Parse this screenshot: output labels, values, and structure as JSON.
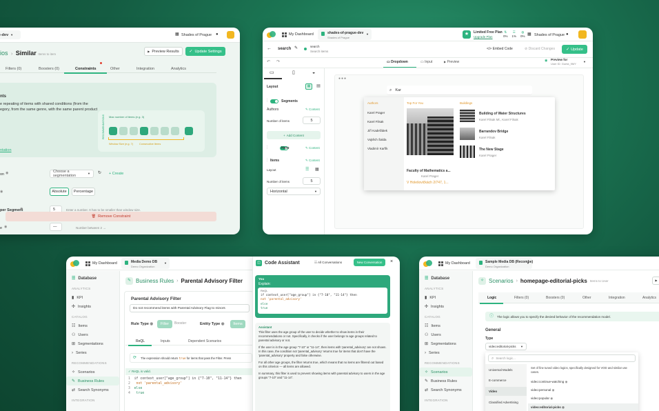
{
  "brand": {
    "green": "#2db37f",
    "yellow": "#f2b720"
  },
  "c1": {
    "project": "ague-dev",
    "org": "Shades of Prague",
    "breadcrumb_a": "ios",
    "breadcrumb_b": "Similar",
    "breadcrumb_c": "Items to item",
    "preview_btn": "Preview Results",
    "update_btn": "Update Settings",
    "tabs": [
      "Filters (0)",
      "Boosters (0)",
      "Constraints",
      "Other",
      "Integration",
      "Analytics"
    ],
    "banner_lines": [
      "nts",
      "e repeating of items with shared conditions (from the",
      "egory, from the same genre, with the same parent product"
    ],
    "banner_link": "ntation",
    "diag_max": "Max number of items (e.g. 3)",
    "diag_window": "Window Size (e.g. 7)",
    "diag_consec": "Consecutive Items",
    "diag_side": "RECOMMENDATIONS",
    "row1_label": "on",
    "row1_select": "Choose a segmentation",
    "row1_create": "Create",
    "row2_opt_a": "Absolute",
    "row2_opt_b": "Percentage",
    "row3_label": "per Segment",
    "row3_value": "5",
    "row3_hint": "Enter a number. It has to be smaller than window size.",
    "row4_label": "e",
    "row4_value": "—",
    "row4_hint": "Number between 2 →",
    "remove_btn": "Remove Constraint"
  },
  "c2": {
    "dashboard": "My Dashboard",
    "project": "shades-of-prague-dev",
    "project_sub": "Shades of Prague",
    "plan": "Limited Free Plan",
    "upgrade": "Upgrade Plan",
    "usage": [
      "0%",
      "1%",
      "0%"
    ],
    "org": "Shades of Prague",
    "page_title": "search",
    "status_title": "search",
    "status_sub": "Search items",
    "embed": "Embed Code",
    "discard": "Discard Changes",
    "update": "Update",
    "modes": [
      "Dropdown",
      "Input",
      "Preview"
    ],
    "preview_for": "Preview for",
    "preview_user": "User ID: Guest_9MY",
    "layout_label": "Layout",
    "segments": "Segments",
    "authors": "Authors",
    "content": "Content",
    "num_items": "Number of items",
    "num_value": "5",
    "add_content": "Add Content",
    "hero": "Hero",
    "items": "Items",
    "layout2": "Layout",
    "num_items2": "Number of items",
    "num_value2": "5",
    "orientation": "Horizontal",
    "search_value": "Kar",
    "col_authors": "Authors",
    "col_top": "Top For You",
    "col_buildings": "Buildings",
    "author_list": [
      "Karel Prager",
      "Karel Filsak",
      "Jiří Kadeřábek",
      "Vojtěch Šalda",
      "Vladimír Karfík"
    ],
    "top_title": "Faculty of Mathematics a...",
    "top_author": "Karel Prager",
    "top_addr": "V Holešovičkách 2/747, 1...",
    "buildings": [
      {
        "name": "Building of Water Structures",
        "sub": "Karel Filsak Ml., Karel Filsak"
      },
      {
        "name": "Barrandov Bridge",
        "sub": "Karel Filsak"
      },
      {
        "name": "The New Stage",
        "sub": "Karel Prager"
      }
    ]
  },
  "c3": {
    "dashboard": "My Dashboard",
    "project": "Media Demo DB",
    "project_sub": "Demo Organization",
    "db": "Database",
    "sections": {
      "analytics": "ANALYTICS",
      "catalog": "CATALOG",
      "recs": "RECOMMENDATIONS",
      "integration": "INTEGRATION"
    },
    "analytics": [
      "KPI",
      "Insights"
    ],
    "catalog": [
      "Items",
      "Users",
      "Segmentations",
      "Series"
    ],
    "recs": [
      "Scenarios",
      "Business Rules",
      "Search Synonyms"
    ],
    "crumb_a": "Business Rules",
    "crumb_b": "Parental Advisory Filter",
    "form_title": "Parental Advisory Filter",
    "form_desc": "Do not recommend items with Parental Advisory Flag to minors",
    "rule_type": "Rule Type",
    "rule_opts": [
      "Filter",
      "Booster"
    ],
    "entity_type": "Entity Type",
    "entity_opt": "Items",
    "subtabs": [
      "ReQL",
      "Inputs",
      "Dependent Scenarios"
    ],
    "hint_a": "The expression should return",
    "hint_true": "true",
    "hint_b": "for items that pass the Filter. Press",
    "valid": "ReQL is valid.",
    "code": [
      "if context_user[\"age_group\"] in {\"7-10\", \"11-14\"} then",
      "  not 'parental_advisory'",
      "else",
      "  true"
    ],
    "assistant": "Code Assistant",
    "all_conv": "All Conversations",
    "new_conv": "New Conversation",
    "you": "You",
    "explain": "Explain:",
    "q_label": "ReQL",
    "q_code": [
      "if context_user[\"age_group\"] in {\"7-10\", \"11-14\"} then",
      "  not 'parental_advisory'",
      "else",
      "  true"
    ],
    "a_label": "Assistant",
    "a_p1": "This filter uses the age group of the user to decide whether to show items in their recommendations or not. Specifically, it checks if the user belongs to age groups related to parental advisory or not.",
    "a_p2": "If the user is in the age group \"7-10\" or \"11-14\", then items with 'parental_advisory' are not shown. In this case, the condition not 'parental_advisory' returns true for items that don't have the 'parental_advisory' property and false otherwise.",
    "a_p3": "For all other age groups, the filter returns true, which means that no items are filtered out based on this criterion — all items are allowed.",
    "a_p4": "In summary, this filter is used to prevent showing items with parental advisory to users in the age groups \"7-10\" and \"11-14\"."
  },
  "c4": {
    "dashboard": "My Dashboard",
    "project": "Sample Media DB (Recombe)",
    "project_sub": "Demo Organization",
    "db": "Database",
    "sections": {
      "analytics": "ANALYTICS",
      "catalog": "CATALOG",
      "recs": "RECOMMENDATIONS",
      "integration": "INTEGRATION"
    },
    "analytics": [
      "KPI",
      "Insights"
    ],
    "catalog": [
      "Items",
      "Users",
      "Segmentations",
      "Series"
    ],
    "recs": [
      "Scenarios",
      "Business Rules",
      "Search Synonyms"
    ],
    "crumb_a": "Scenarios",
    "crumb_b": "homepage-editorial-picks",
    "crumb_c": "Items to User",
    "tabs": [
      "Logic",
      "Filters (0)",
      "Boosters (0)",
      "Other",
      "Integration",
      "Analytics"
    ],
    "info": "The logic allows you to specify the desired behavior of the recommendation model.",
    "general": "General",
    "type_label": "Type",
    "type_value": "video:editorial-picks",
    "search_ph": "Search logic...",
    "cats": [
      "Universal Models",
      "E-commerce",
      "Video",
      "Classified Advertising"
    ],
    "desc": "Set of fine tuned video logics, specifically designed for VOD and similar use cases.",
    "opts": [
      "video:continue-watching",
      "video:personal",
      "video:popular",
      "video:editorial-picks"
    ]
  }
}
